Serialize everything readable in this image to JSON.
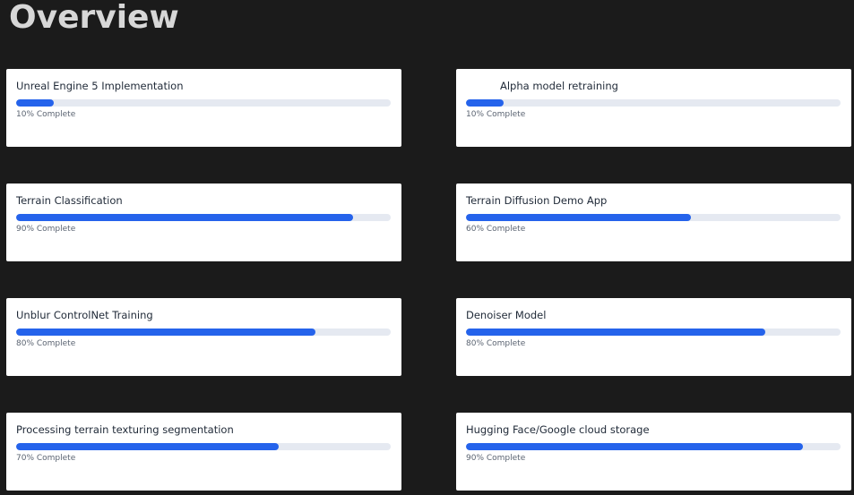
{
  "page": {
    "title": "Overview"
  },
  "colors": {
    "background": "#1b1b1b",
    "card": "#ffffff",
    "progress_fill": "#2563eb",
    "progress_track": "#e5e9f1",
    "title_text": "#d7d7d7"
  },
  "projects": [
    {
      "name": "Unreal Engine 5 Implementation",
      "progress": 10,
      "status": "10% Complete"
    },
    {
      "name": "Alpha model retraining",
      "progress": 10,
      "status": "10% Complete"
    },
    {
      "name": "Terrain Classification",
      "progress": 90,
      "status": "90% Complete"
    },
    {
      "name": "Terrain Diffusion Demo App",
      "progress": 60,
      "status": "60% Complete"
    },
    {
      "name": "Unblur ControlNet Training",
      "progress": 80,
      "status": "80% Complete"
    },
    {
      "name": "Denoiser Model",
      "progress": 80,
      "status": "80% Complete"
    },
    {
      "name": "Processing terrain texturing segmentation",
      "progress": 70,
      "status": "70% Complete"
    },
    {
      "name": "Hugging Face/Google cloud storage",
      "progress": 90,
      "status": "90% Complete"
    }
  ]
}
